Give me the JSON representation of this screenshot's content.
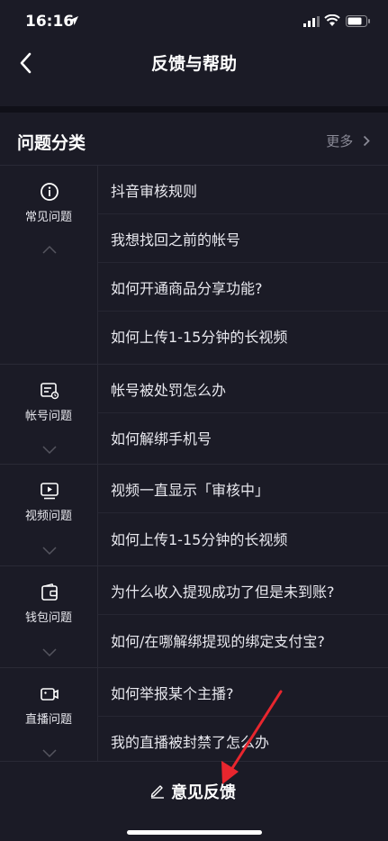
{
  "status_bar": {
    "time": "16:16"
  },
  "nav": {
    "title": "反馈与帮助"
  },
  "section": {
    "title": "问题分类",
    "more": "更多"
  },
  "categories": [
    {
      "label": "常见问题",
      "icon": "info-icon",
      "expanded": true,
      "questions": [
        "抖音审核规则",
        "我想找回之前的帐号",
        "如何开通商品分享功能?",
        "如何上传1-15分钟的长视频"
      ]
    },
    {
      "label": "帐号问题",
      "icon": "account-card-icon",
      "expanded": false,
      "questions": [
        "帐号被处罚怎么办",
        "如何解绑手机号"
      ]
    },
    {
      "label": "视频问题",
      "icon": "video-play-icon",
      "expanded": false,
      "questions": [
        "视频一直显示「审核中」",
        "如何上传1-15分钟的长视频"
      ]
    },
    {
      "label": "钱包问题",
      "icon": "wallet-icon",
      "expanded": false,
      "questions": [
        "为什么收入提现成功了但是未到账?",
        "如何/在哪解绑提现的绑定支付宝?"
      ]
    },
    {
      "label": "直播问题",
      "icon": "live-camera-icon",
      "expanded": false,
      "questions": [
        "如何举报某个主播?",
        "我的直播被封禁了怎么办"
      ]
    }
  ],
  "bottom": {
    "feedback_label": "意见反馈"
  },
  "colors": {
    "background": "#1b1b26",
    "divider": "#2a2a36",
    "annotation_arrow": "#e8262e"
  }
}
